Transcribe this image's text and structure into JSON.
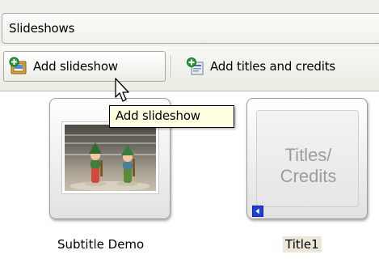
{
  "header": {
    "title": "Slideshows"
  },
  "toolbar": {
    "add_slideshow_label": "Add slideshow",
    "add_titles_label": "Add titles and credits"
  },
  "tooltip": {
    "text": "Add slideshow"
  },
  "items": [
    {
      "caption": "Subtitle Demo",
      "selected": false
    },
    {
      "caption": "Title1",
      "title_card_line1": "Titles/",
      "title_card_line2": "Credits",
      "selected": true
    }
  ],
  "icons": {
    "add_slideshow": "add-slideshow-icon",
    "add_titles": "add-titles-icon",
    "cursor": "mouse-cursor-icon",
    "badge": "play-back-badge-icon"
  },
  "colors": {
    "tooltip_bg": "#ffffe1",
    "selected_caption_bg": "#ece8d8",
    "badge_blue": "#1d3fd6",
    "title_card_text": "#9d9d9d"
  }
}
